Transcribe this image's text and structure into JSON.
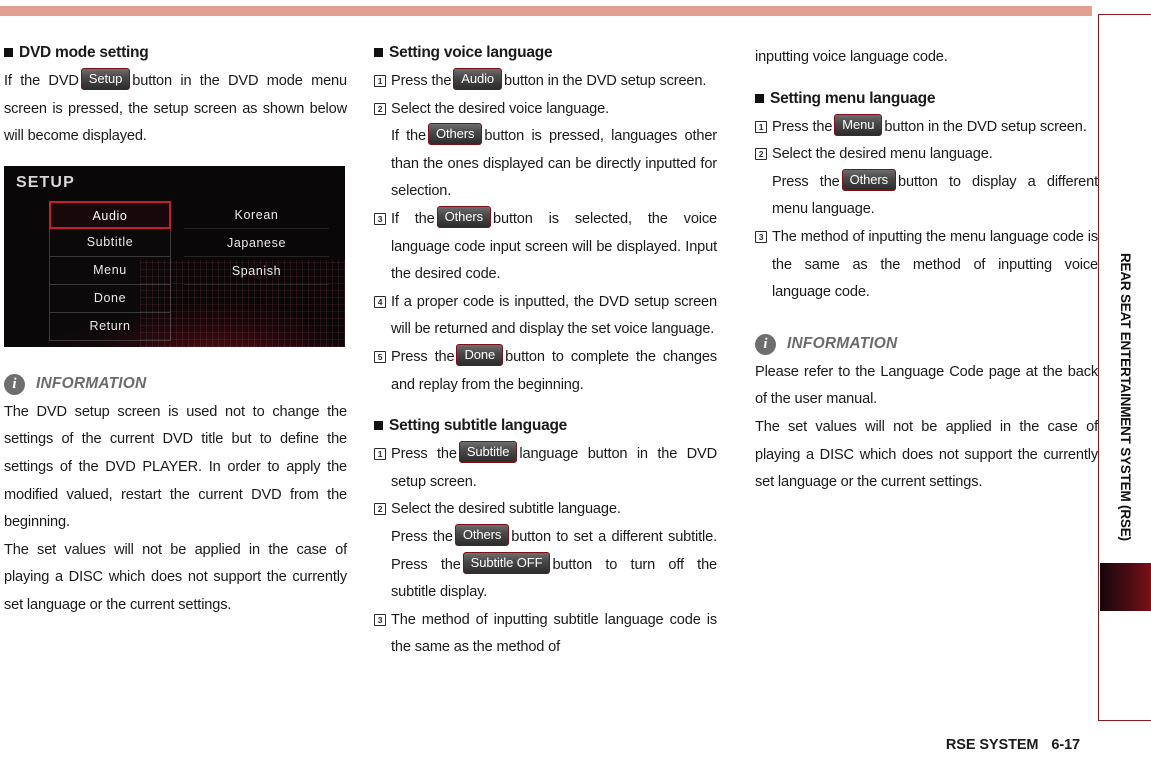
{
  "sidebar": {
    "vertical_label": "REAR SEAT ENTERTAINMENT SYSTEM (RSE)"
  },
  "footer": {
    "section": "RSE SYSTEM",
    "page": "6-17"
  },
  "colors": {
    "top_bar": "#e0a193",
    "sidebar_border": "#8b1a1e",
    "tab_gradient_end": "#7e1118",
    "key_border": "#7c1016",
    "setup_selected_border": "#c51f2c",
    "info_icon": "#6e6e6e"
  },
  "column_left": {
    "heading": "DVD mode setting",
    "intro_part1": "If the DVD",
    "intro_key": "Setup",
    "intro_part2": "button in the DVD mode menu screen is pressed, the setup screen as shown below will become displayed.",
    "setup_screen": {
      "title": "SETUP",
      "menu_items": [
        "Audio",
        "Subtitle",
        "Menu",
        "Done",
        "Return"
      ],
      "selected_item": "Audio",
      "languages": [
        "Korean",
        "Japanese",
        "Spanish"
      ]
    },
    "information": {
      "title": "INFORMATION",
      "icon": "info-circle-icon",
      "paragraphs": [
        "The DVD setup screen is used not to change the settings of the current DVD title but to define the settings of the DVD PLAYER. In order to apply the modified valued, restart the current DVD from the beginning.",
        "The set values will not be applied in the case of  playing a DISC which does not support the currently set language or the current settings."
      ]
    }
  },
  "column_middle": {
    "section_voice": {
      "heading": "Setting voice language",
      "steps": [
        {
          "num": "1",
          "text_before": "Press the",
          "key": "Audio",
          "text_after": "button in the DVD setup screen."
        },
        {
          "num": "2",
          "line1": "Select the desired voice language.",
          "text_before": "If the",
          "key": "Others",
          "text_after": "button is pressed, languages other than the ones displayed can be directly inputted for selection."
        },
        {
          "num": "3",
          "text_before": "If the",
          "key": "Others",
          "text_after": "button is selected, the voice language code input screen will be displayed. Input the desired code."
        },
        {
          "num": "4",
          "text_before": "",
          "key": "",
          "text_after": "If a proper code is inputted, the DVD setup screen will be returned and display the set voice language."
        },
        {
          "num": "5",
          "text_before": "Press the",
          "key": "Done",
          "text_after": "button to complete the changes and replay from the beginning."
        }
      ]
    },
    "section_subtitle": {
      "heading": "Setting subtitle language",
      "step1_before": "Press the",
      "step1_key": "Subtitle",
      "step1_after": "language button in the DVD setup screen.",
      "step2_line1": "Select the desired subtitle language.",
      "step2_before": "Press the",
      "step2_key1": "Others",
      "step2_mid": "button to set a different subtitle. Press the",
      "step2_key2": "Subtitle OFF",
      "step2_after": "button to turn off the subtitle display.",
      "step3": "The method of inputting subtitle language code is the same as the method of"
    }
  },
  "column_right": {
    "continuation": "inputting voice language code.",
    "section_menu": {
      "heading": "Setting menu language",
      "step1_before": "Press the",
      "step1_key": "Menu",
      "step1_after": "button in the DVD setup screen.",
      "step2_line1": "Select the desired menu language.",
      "step2_before": "Press the",
      "step2_key": "Others",
      "step2_after": "button to display a different menu language.",
      "step3": "The method of inputting the menu language code is the same as the method of inputting voice language code."
    },
    "information": {
      "title": "INFORMATION",
      "icon": "info-circle-icon",
      "paragraphs": [
        "Please refer to the Language Code page at the back of the user manual.",
        "The set values will not be applied in the case of  playing a DISC which does not support the currently set language or the current settings."
      ]
    }
  }
}
